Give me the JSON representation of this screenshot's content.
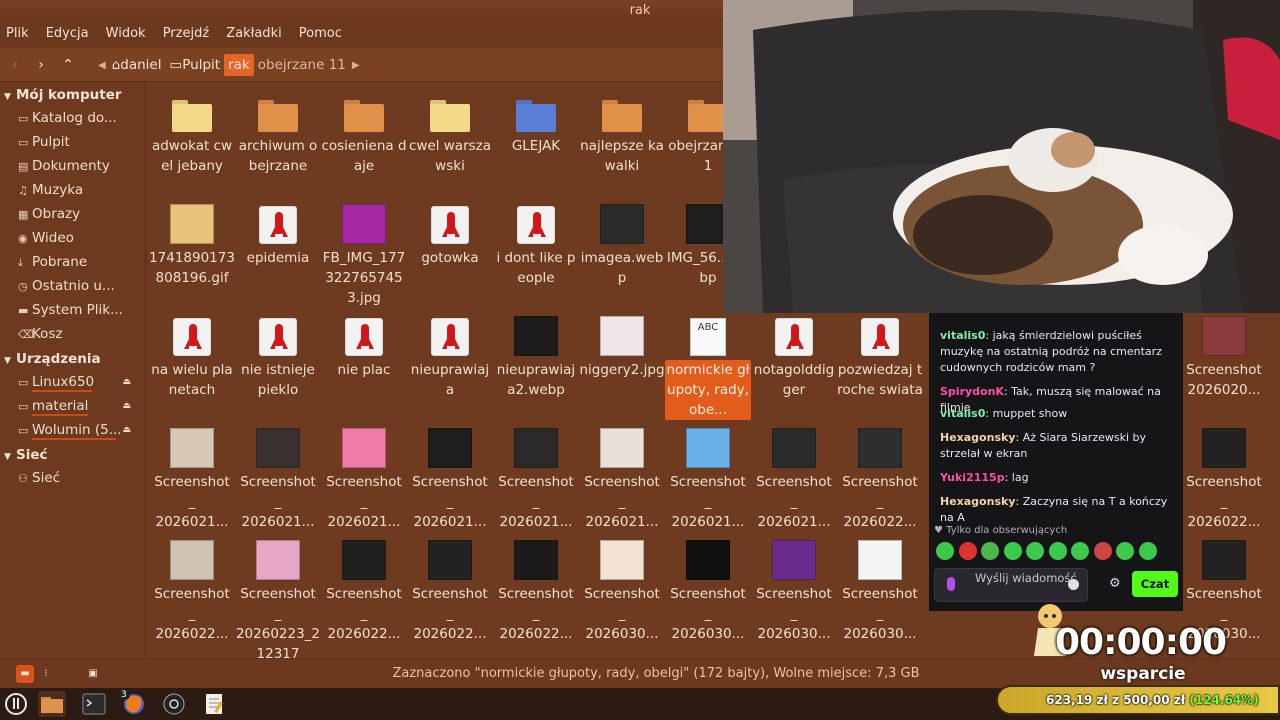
{
  "window": {
    "title": "rak"
  },
  "menu": [
    "Plik",
    "Edycja",
    "Widok",
    "Przejdź",
    "Zakładki",
    "Pomoc"
  ],
  "breadcrumb": [
    "daniel",
    "Pulpit",
    "rak",
    "obejrzane 11"
  ],
  "sidebar": {
    "computer_header": "Mój komputer",
    "computer_items": [
      {
        "icon": "folder-icon",
        "label": "Katalog do..."
      },
      {
        "icon": "desktop-icon",
        "label": "Pulpit"
      },
      {
        "icon": "documents-icon",
        "label": "Dokumenty"
      },
      {
        "icon": "music-icon",
        "label": "Muzyka"
      },
      {
        "icon": "pictures-icon",
        "label": "Obrazy"
      },
      {
        "icon": "video-icon",
        "label": "Wideo"
      },
      {
        "icon": "download-icon",
        "label": "Pobrane"
      },
      {
        "icon": "recent-icon",
        "label": "Ostatnio u..."
      },
      {
        "icon": "drive-icon",
        "label": "System Plik..."
      },
      {
        "icon": "trash-icon",
        "label": "Kosz"
      }
    ],
    "devices_header": "Urządzenia",
    "devices": [
      {
        "label": "Linux650"
      },
      {
        "label": "material"
      },
      {
        "label": "Wolumin (5..."
      }
    ],
    "network_header": "Sieć",
    "network_items": [
      {
        "label": "Sieć"
      }
    ]
  },
  "files": [
    {
      "name": "adwokat cwel jebany",
      "kind": "folder",
      "color": "#f3d98a"
    },
    {
      "name": "archiwum obejrzane",
      "kind": "folder",
      "color": "#e09048"
    },
    {
      "name": "cosieniena daje",
      "kind": "folder",
      "color": "#e09048"
    },
    {
      "name": "cwel warszawski",
      "kind": "folder",
      "color": "#f3d98a"
    },
    {
      "name": "GLEJAK",
      "kind": "folder",
      "color": "#5b7fd6"
    },
    {
      "name": "najlepsze kawalki",
      "kind": "folder",
      "color": "#e09048"
    },
    {
      "name": "obejrzane 11",
      "kind": "folder",
      "color": "#e09048"
    },
    {
      "name": "1741890173808196.gif",
      "kind": "thumb",
      "color": "#e8c27a"
    },
    {
      "name": "epidemia",
      "kind": "rocket"
    },
    {
      "name": "FB_IMG_1773227657453.jpg",
      "kind": "thumb",
      "color": "#a52aa3"
    },
    {
      "name": "gotowka",
      "kind": "rocket"
    },
    {
      "name": "i dont like people",
      "kind": "rocket"
    },
    {
      "name": "imagea.webp",
      "kind": "thumb",
      "color": "#2b2b2b"
    },
    {
      "name": "IMG_56...webp",
      "kind": "thumb",
      "color": "#1e1e1e"
    },
    {
      "name": "na wielu planetach",
      "kind": "rocket"
    },
    {
      "name": "nie istnieje pieklo",
      "kind": "rocket"
    },
    {
      "name": "nie plac",
      "kind": "rocket"
    },
    {
      "name": "nieuprawiaja",
      "kind": "rocket"
    },
    {
      "name": "nieuprawiaja2.webp",
      "kind": "thumb",
      "color": "#1c1c1c"
    },
    {
      "name": "niggery2.jpg",
      "kind": "thumb",
      "color": "#f0e6ea"
    },
    {
      "name": "normickie głupoty, rady, obe...",
      "kind": "text",
      "selected": true
    },
    {
      "name": "notagolddigger",
      "kind": "rocket"
    },
    {
      "name": "pozwiedzaj troche swiata",
      "kind": "rocket"
    }
  ],
  "screenshot_label": "Screenshot",
  "screenshot_rows": [
    {
      "names": [
        "2026021...",
        "2026021...",
        "2026021...",
        "2026021...",
        "2026021...",
        "2026021...",
        "2026021...",
        "2026021...",
        "2026022..."
      ],
      "colors": [
        "#d7c8b5",
        "#3b3030",
        "#f07aa8",
        "#1e1e1e",
        "#2a2a2a",
        "#e9e1d8",
        "#6ab1ea",
        "#2b2b2b",
        "#2e2e30"
      ]
    },
    {
      "names": [
        "2026022...",
        "20260223_212317",
        "2026022...",
        "2026022...",
        "2026022...",
        "2026030...",
        "2026030...",
        "2026030...",
        "2026030..."
      ],
      "colors": [
        "#cfc2b3",
        "#e6a7c4",
        "#202020",
        "#222222",
        "#1b1b1b",
        "#f3e3d3",
        "#111111",
        "#6a2c8a",
        "#f4f4f4"
      ]
    }
  ],
  "right_column": {
    "name_row1": "2026020...",
    "name_row2": "2026022...",
    "name_row3": "2026030...",
    "partial_row3": [
      "2026030...",
      "2026030..."
    ]
  },
  "status": "Zaznaczono \"normickie głupoty, rady, obelgi\" (172 bajty), Wolne miejsce: 7,3 GB",
  "taskbar": {
    "badge": "3"
  },
  "chat": {
    "messages": [
      {
        "user": "vitalis0",
        "color": "#7ff0a8",
        "text": "jaką śmierdzielowi puściłeś muzykę na ostatnią podróż na cmentarz cudownych rodziców mam ?"
      },
      {
        "user": "SpirydonK",
        "color": "#ff4fa3",
        "text": "Tak, muszą się malować na filmie"
      },
      {
        "user": "vitalis0",
        "color": "#7ff0a8",
        "text": "muppet show"
      },
      {
        "user": "Hexagonsky",
        "color": "#f4d6a6",
        "text": "Aż Siara Siarzewski by strzelał w ekran"
      },
      {
        "user": "Yuki2115p",
        "color": "#ff4fa3",
        "text": "lag"
      },
      {
        "user": "Hexagonsky",
        "color": "#f4d6a6",
        "text": "Zaczyna się na T a kończy na A"
      }
    ],
    "follow_only": "Tylko dla obserwujących",
    "input_placeholder": "Wyślij wiadomość",
    "send_label": "Czat"
  },
  "overlay": {
    "timer": "00:00:00",
    "support_label": "wsparcie",
    "goal_text": "623,19 zł z 500,00 zł ",
    "goal_pct": "(124.64%)",
    "goal_progress": 1.2464
  }
}
